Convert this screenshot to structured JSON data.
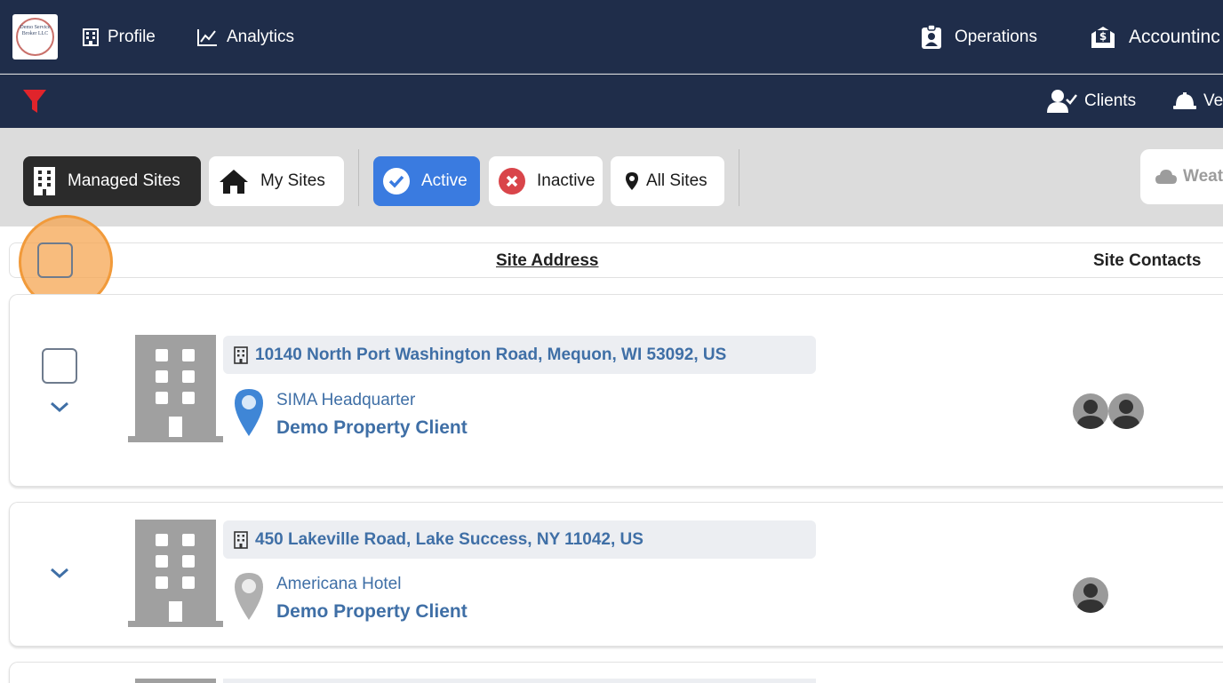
{
  "topnav": {
    "logo_text": "Demo Service Broker LLC",
    "profile": "Profile",
    "analytics": "Analytics",
    "operations": "Operations",
    "accounting": "Accountinc"
  },
  "subnav": {
    "clients": "Clients",
    "vendors": "Ve"
  },
  "toolbar": {
    "managed_sites": "Managed Sites",
    "my_sites": "My Sites",
    "active": "Active",
    "inactive": "Inactive",
    "all_sites": "All Sites",
    "weather": "Weat"
  },
  "table": {
    "headers": {
      "site_address": "Site Address",
      "site_contacts": "Site Contacts"
    },
    "rows": [
      {
        "address": "10140 North Port Washington Road, Mequon, WI 53092, US",
        "site_name": "SIMA Headquarter",
        "client": "Demo Property Client",
        "pin_color": "#3f86d6",
        "contacts": 2
      },
      {
        "address": "450 Lakeville Road, Lake Success, NY 11042, US",
        "site_name": "Americana Hotel",
        "client": "Demo Property Client",
        "pin_color": "#b0b0b0",
        "contacts": 1
      }
    ]
  },
  "colors": {
    "nav_bg": "#1f2d4a",
    "accent_blue": "#3a7be0",
    "link_blue": "#3f6fa6",
    "filter_red": "#e0242b",
    "highlight_orange": "#f19a3a"
  }
}
